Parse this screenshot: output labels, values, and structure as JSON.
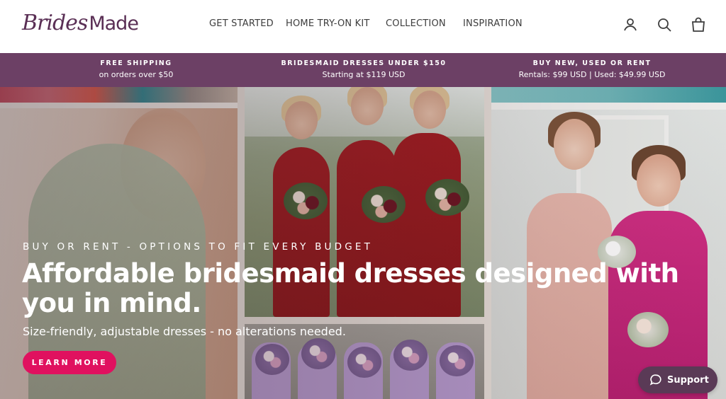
{
  "brand": {
    "logo_script": "Brides",
    "logo_sans": "Made",
    "color": "#5a2f55"
  },
  "nav": {
    "items": [
      {
        "label": "GET STARTED"
      },
      {
        "label": "HOME TRY-ON KIT"
      },
      {
        "label": "COLLECTION"
      },
      {
        "label": "INSPIRATION"
      }
    ],
    "icons": [
      "account-icon",
      "search-icon",
      "cart-icon"
    ]
  },
  "announcement": {
    "background": "#6c4065",
    "items": [
      {
        "title": "FREE SHIPPING",
        "subtitle": "on orders over $50"
      },
      {
        "title": "BRIDESMAID DRESSES UNDER $150",
        "subtitle": "Starting at $119 USD"
      },
      {
        "title": "BUY NEW, USED OR RENT",
        "subtitle": "Rentals: $99 USD | Used: $49.99 USD"
      }
    ]
  },
  "hero": {
    "eyebrow": "BUY OR RENT - OPTIONS TO FIT EVERY BUDGET",
    "title": "Affordable bridesmaid dresses designed with you in mind.",
    "subtitle": "Size-friendly, adjustable dresses - no alterations needed.",
    "cta_label": "LEARN MORE",
    "cta_color": "#e0115f"
  },
  "support": {
    "label": "Support",
    "icon": "chat-bubble-icon",
    "color": "#5a3a56"
  }
}
